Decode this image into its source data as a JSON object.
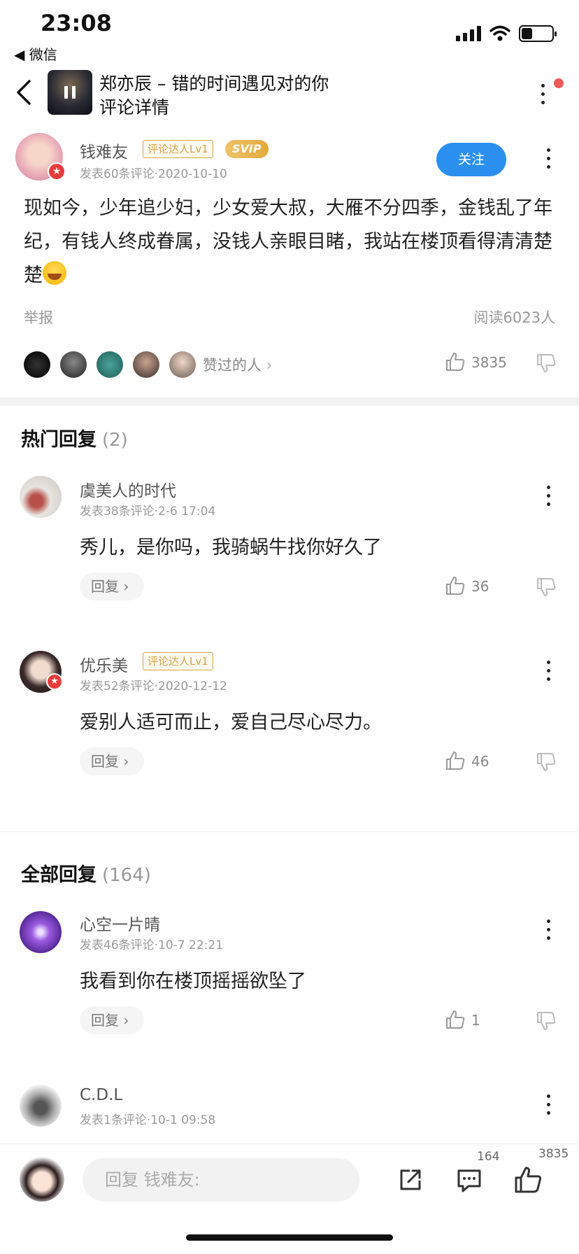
{
  "status_bar": {
    "time": "23:08",
    "back_app": "◀ 微信",
    "battery_level": 0.35
  },
  "nav": {
    "title": "郑亦辰 – 错的时间遇见对的你",
    "subtitle": "评论详情"
  },
  "main_comment": {
    "username": "钱难友",
    "badge": "评论达人Lv1",
    "vip": "SVIP",
    "meta": "发表60条评论·2020-10-10",
    "follow_label": "关注",
    "text": "现如今，少年追少妇，少女爱大叔，大雁不分四季，金钱乱了年纪，有钱人终成眷属，没钱人亲眼目睹，我站在楼顶看得清清楚楚",
    "report_label": "举报",
    "reads": "阅读6023人",
    "likers_label": "赞过的人",
    "like_count": "3835"
  },
  "hot_replies": {
    "title": "热门回复",
    "count": "(2)",
    "items": [
      {
        "username": "虞美人的时代",
        "meta": "发表38条评论·2-6 17:04",
        "text": "秀儿，是你吗，我骑蜗牛找你好久了",
        "reply_label": "回复",
        "like_count": "36"
      },
      {
        "username": "优乐美",
        "badge": "评论达人Lv1",
        "meta": "发表52条评论·2020-12-12",
        "text": "爱别人适可而止，爱自己尽心尽力。",
        "reply_label": "回复",
        "like_count": "46"
      }
    ]
  },
  "all_replies": {
    "title": "全部回复",
    "count": "(164)",
    "items": [
      {
        "username": "心空一片晴",
        "meta": "发表46条评论·10-7 22:21",
        "text": "我看到你在楼顶摇摇欲坠了",
        "reply_label": "回复",
        "like_count": "1"
      },
      {
        "username": "C.D.L",
        "meta": "发表1条评论·10-1 09:58"
      }
    ]
  },
  "bottom_bar": {
    "input_placeholder": "回复 钱难友:",
    "comment_count": "164",
    "like_count": "3835"
  },
  "colors": {
    "accent": "#2b8ff0",
    "badge_gold": "#d4a44a",
    "notify_red": "#f25a5a"
  },
  "icons": [
    "back-chevron-icon",
    "pause-icon",
    "more-vertical-icon",
    "thumbs-up-icon",
    "thumbs-down-icon",
    "share-icon",
    "comment-icon",
    "chevron-right-icon"
  ]
}
